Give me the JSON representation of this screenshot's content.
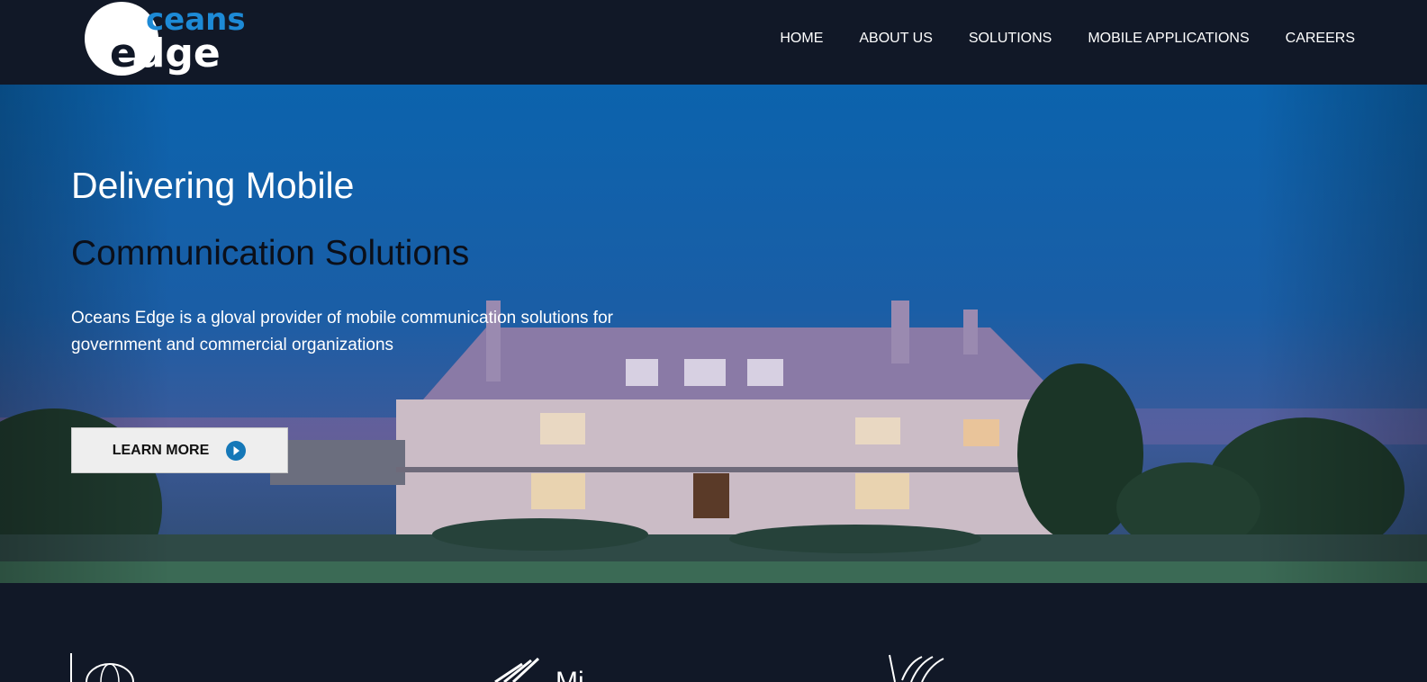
{
  "brand": {
    "logo_top": "ceans",
    "logo_bottom": "dge",
    "accent": "#1d8ad6",
    "background": "#111827"
  },
  "nav": {
    "items": [
      {
        "label": "HOME"
      },
      {
        "label": "ABOUT US"
      },
      {
        "label": "SOLUTIONS"
      },
      {
        "label": "MOBILE APPLICATIONS"
      },
      {
        "label": "CAREERS"
      }
    ]
  },
  "hero": {
    "title_line1": "Delivering Mobile",
    "title_line2": "Communication Solutions",
    "description": "Oceans Edge is a gloval provider of mobile communication solutions for government and commercial organizations",
    "cta_label": "LEARN MORE",
    "cta_icon": "circle-play-icon"
  },
  "features": {
    "items": [
      {
        "icon": "globe-icon"
      },
      {
        "icon": "satellite-dish-icon",
        "label": "Mi"
      },
      {
        "icon": "signal-tower-icon"
      }
    ]
  }
}
